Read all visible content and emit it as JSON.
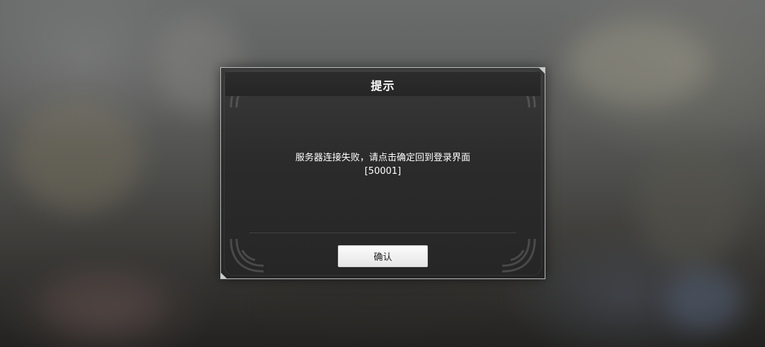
{
  "dialog": {
    "title": "提示",
    "message_line1": "服务器连接失败，请点击确定回到登录界面",
    "message_line2": "[50001]",
    "confirm_label": "确认"
  },
  "colors": {
    "dialog_bg": "#2b2b2b",
    "dialog_border": "#b8bcbc",
    "title_text": "#ffffff",
    "button_bg": "#f2f2f2",
    "button_text": "#222222"
  }
}
